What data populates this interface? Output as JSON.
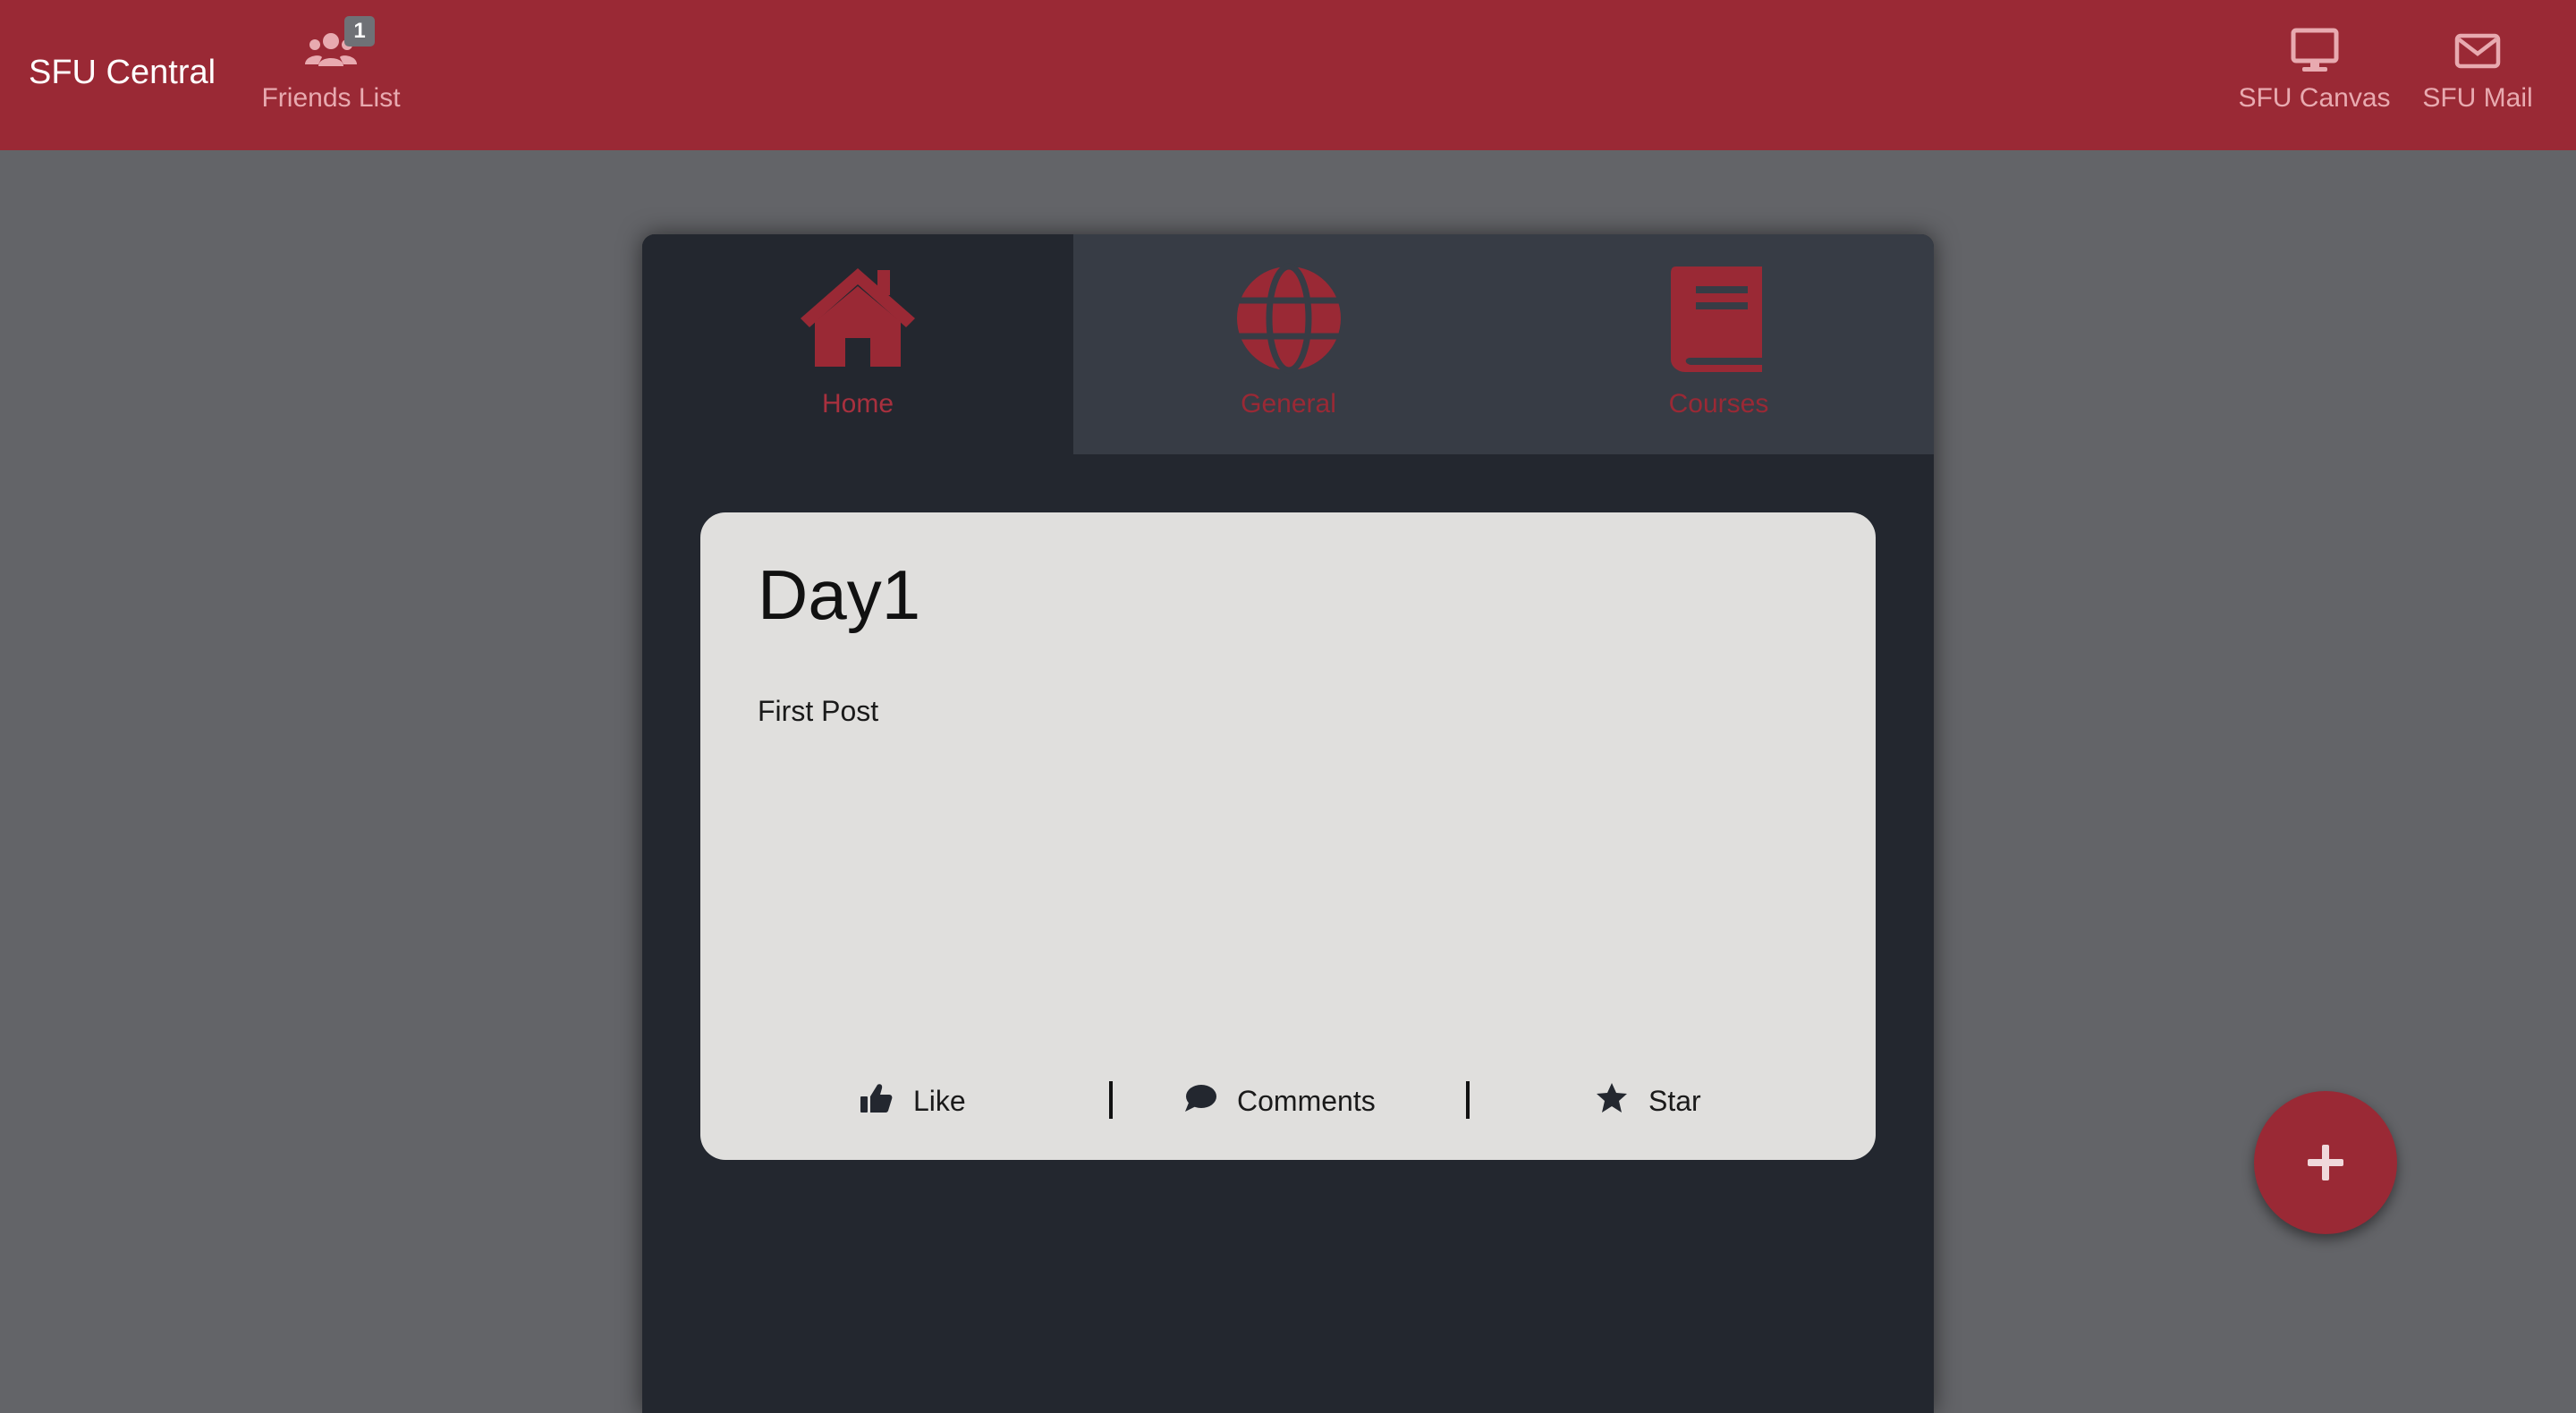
{
  "navbar": {
    "brand": "SFU Central",
    "friends": {
      "label": "Friends List",
      "badge": "1",
      "icon": "users-icon"
    },
    "canvas": {
      "label": "SFU Canvas",
      "icon": "monitor-icon"
    },
    "mail": {
      "label": "SFU Mail",
      "icon": "envelope-icon"
    }
  },
  "tabs": [
    {
      "label": "Home",
      "icon": "home-icon",
      "active": true
    },
    {
      "label": "General",
      "icon": "globe-icon",
      "active": false
    },
    {
      "label": "Courses",
      "icon": "book-icon",
      "active": false
    }
  ],
  "post": {
    "title": "Day1",
    "body": "First Post",
    "actions": {
      "like": "Like",
      "comments": "Comments",
      "star": "Star"
    }
  },
  "fab": {
    "icon": "plus-icon"
  },
  "colors": {
    "brand_red": "#9a2935",
    "page_bg": "#636468",
    "panel_bg": "#23272f",
    "inactive_tab_bg": "#373c45",
    "card_bg": "#e0dfdd"
  }
}
